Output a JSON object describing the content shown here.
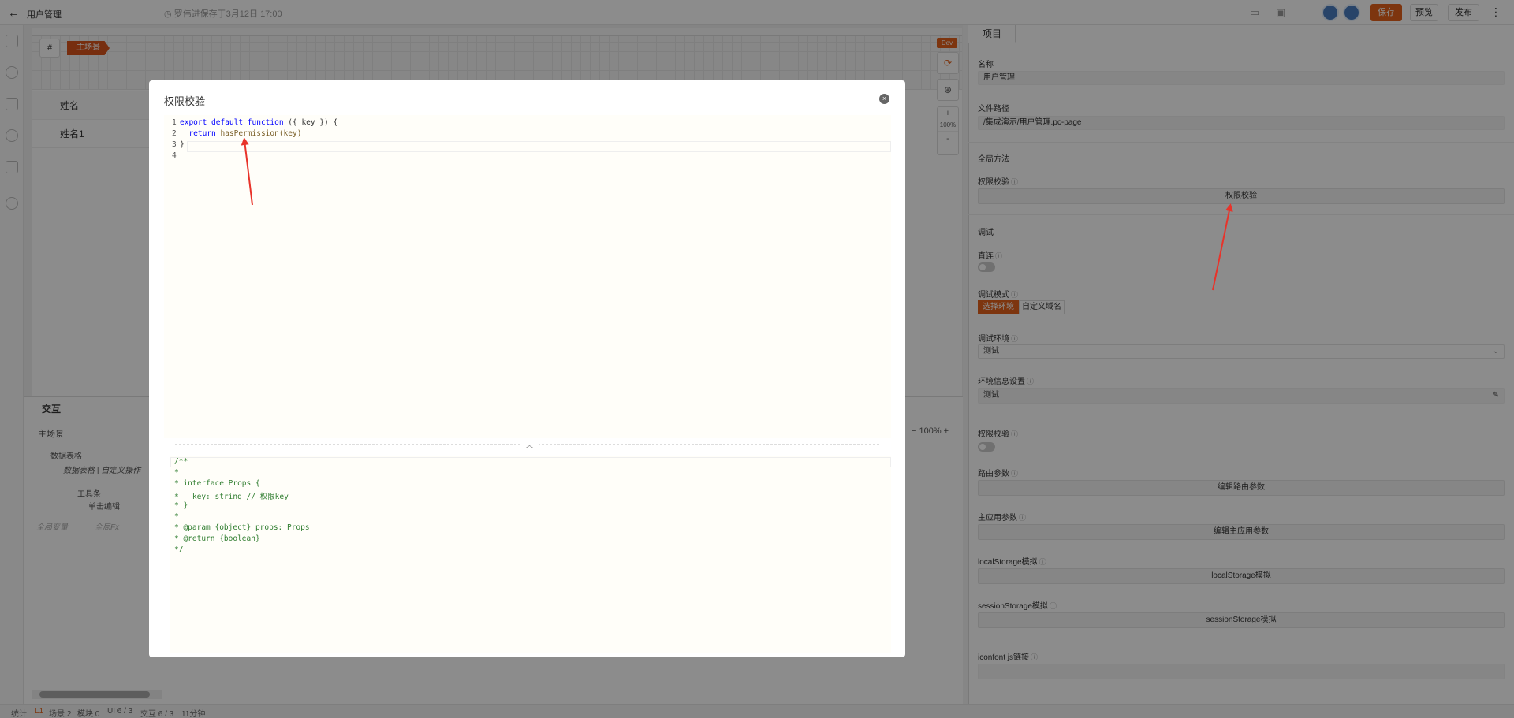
{
  "topbar": {
    "title": "用户管理",
    "save_hint": "罗伟进保存于3月12日 17:00",
    "save": "保存",
    "preview": "预览",
    "publish": "发布"
  },
  "canvas": {
    "scene_tag": "主场景",
    "hash": "#",
    "dev_tag": "Dev",
    "header_cell": "姓名",
    "row_cell": "姓名1",
    "zoom_plus": "+",
    "zoom_value": "100%",
    "zoom_minus": "-"
  },
  "interactions": {
    "title": "交互",
    "tree": [
      "主场景",
      "数据表格",
      "数据表格 | 自定义操作",
      "工具条",
      "单击编辑",
      "全局变量",
      "全局Fx"
    ],
    "zoom_value": "100%"
  },
  "statusbar": {
    "items": [
      "统计",
      "L1",
      "场景 2",
      "模块 0",
      "UI 6 / 3",
      "交互 6 / 3",
      "11分钟"
    ]
  },
  "right_panel": {
    "tab": "项目",
    "name_label": "名称",
    "name_value": "用户管理",
    "path_label": "文件路径",
    "path_value": "/集成演示/用户管理.pc-page",
    "global_methods": "全局方法",
    "perm_label": "权限校验",
    "perm_button": "权限校验",
    "debug": "调试",
    "direct_label": "直连",
    "debug_mode_label": "调试模式",
    "debug_mode_opts": [
      "选择环境",
      "自定义域名"
    ],
    "debug_env_label": "调试环境",
    "debug_env_value": "测试",
    "env_info_label": "环境信息设置",
    "env_info_value": "测试",
    "perm2_label": "权限校验",
    "route_label": "路由参数",
    "route_button": "编辑路由参数",
    "main_app_label": "主应用参数",
    "main_app_button": "编辑主应用参数",
    "ls_label": "localStorage模拟",
    "ls_button": "localStorage模拟",
    "ss_label": "sessionStorage模拟",
    "ss_button": "sessionStorage模拟",
    "iconfont_label": "iconfont js链接"
  },
  "modal": {
    "title": "权限校验",
    "close": "×",
    "code": [
      {
        "n": "1",
        "a": "export default function",
        "b": " ({ key }) {"
      },
      {
        "n": "2",
        "a": "  return ",
        "b": "hasPermission(key)"
      },
      {
        "n": "3",
        "a": "}",
        "b": ""
      },
      {
        "n": "4",
        "a": "",
        "b": ""
      }
    ],
    "doc": [
      "/**",
      "*",
      "* interface Props {",
      "*   key: string // 权限key",
      "* }",
      "*",
      "* @param {object} props: Props",
      "* @return {boolean}",
      "*/"
    ]
  },
  "colors": {
    "accent": "#e3621c",
    "arrow": "#e8332a"
  }
}
